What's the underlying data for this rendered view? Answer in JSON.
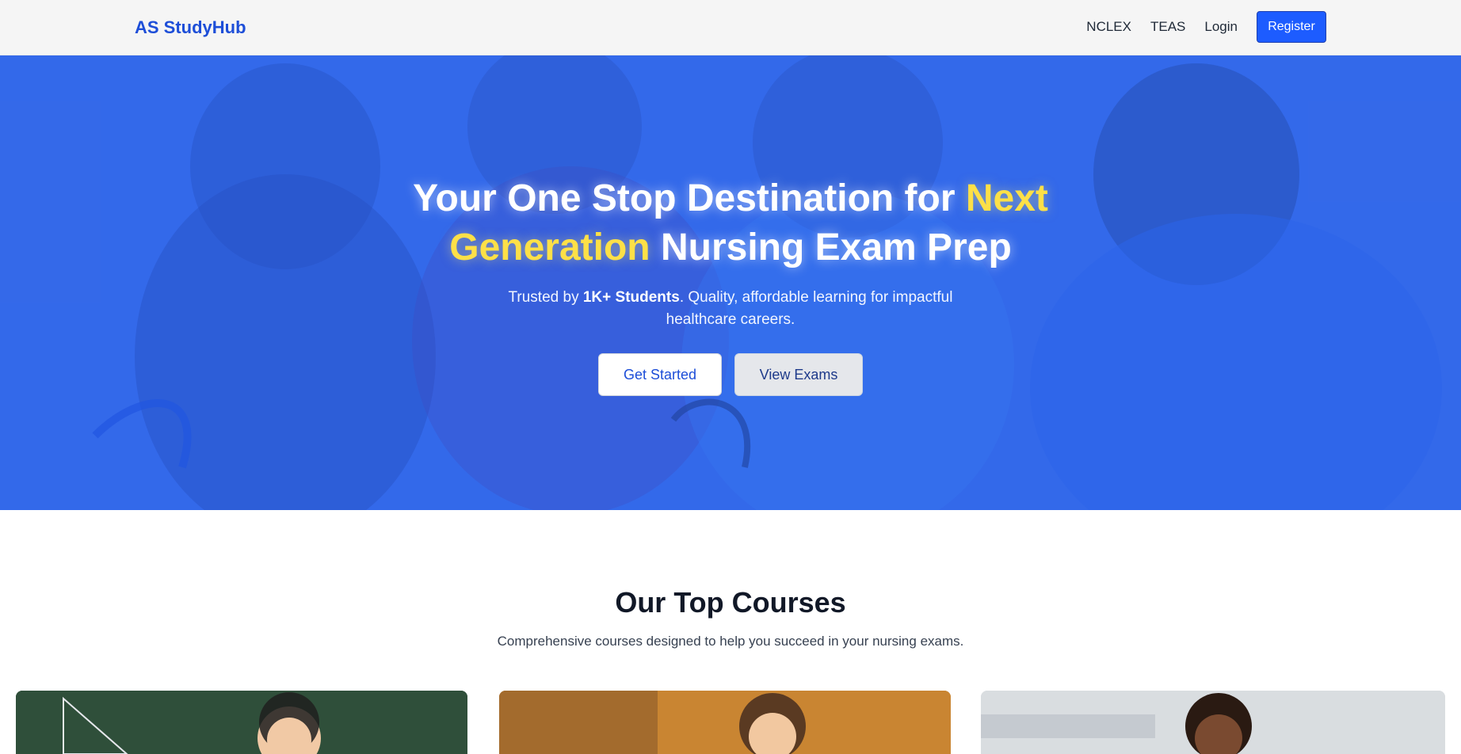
{
  "nav": {
    "brand": "AS StudyHub",
    "links": [
      "NCLEX",
      "TEAS",
      "Login"
    ],
    "register_label": "Register"
  },
  "hero": {
    "title_part1": "Your One Stop Destination for ",
    "title_highlight": "Next Generation",
    "title_part2": " Nursing Exam Prep",
    "subtitle_prefix": "Trusted by ",
    "subtitle_bold": "1K+ Students",
    "subtitle_rest": ". Quality, affordable learning for impactful healthcare careers.",
    "get_started_label": "Get Started",
    "view_exams_label": "View Exams"
  },
  "courses": {
    "title": "Our Top Courses",
    "subtitle": "Comprehensive courses designed to help you succeed in your nursing exams."
  },
  "colors": {
    "brand": "#1d4ed8",
    "register_bg": "#1d5cff",
    "hero_bg": "#3569ec",
    "highlight": "#fde047"
  }
}
